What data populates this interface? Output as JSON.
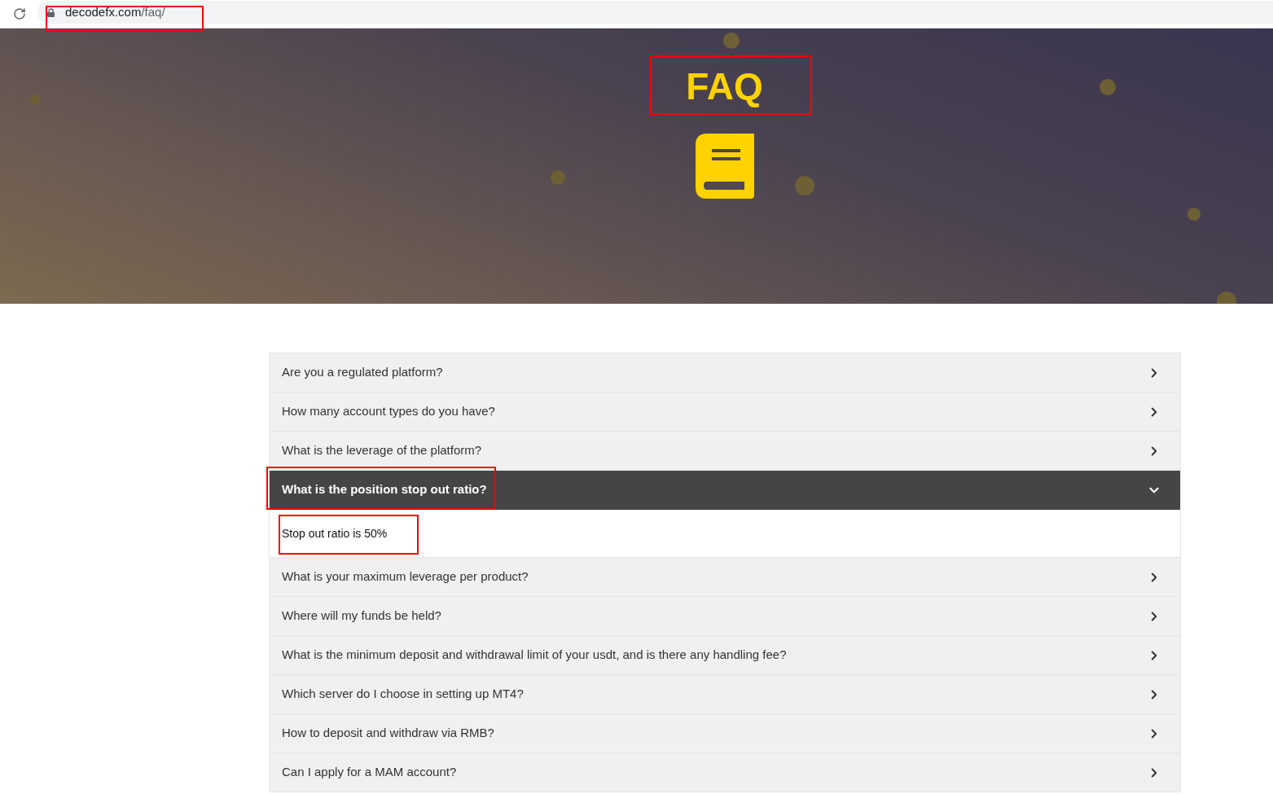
{
  "browser": {
    "url_host": "decodefx.com",
    "url_path": "/faq/",
    "highlighted": true
  },
  "hero": {
    "title": "FAQ",
    "highlighted": true
  },
  "faq": [
    {
      "question": "Are you a regulated platform?",
      "expanded": false,
      "highlighted": false
    },
    {
      "question": "How many account types do you have?",
      "expanded": false,
      "highlighted": false
    },
    {
      "question": "What is the leverage of the platform?",
      "expanded": false,
      "highlighted": false
    },
    {
      "question": "What is the position stop out ratio?",
      "expanded": true,
      "highlighted": true,
      "answer": {
        "text": "Stop out ratio is 50%",
        "highlighted": true
      }
    },
    {
      "question": "What is your maximum leverage per product?",
      "expanded": false,
      "highlighted": false
    },
    {
      "question": "Where will my funds be held?",
      "expanded": false,
      "highlighted": false
    },
    {
      "question": "What is the minimum deposit and withdrawal limit of your usdt, and is there any handling fee?",
      "expanded": false,
      "highlighted": false
    },
    {
      "question": "Which server do I choose in setting up MT4?",
      "expanded": false,
      "highlighted": false
    },
    {
      "question": "How to deposit and withdraw via RMB?",
      "expanded": false,
      "highlighted": false
    },
    {
      "question": "Can I apply for a MAM account?",
      "expanded": false,
      "highlighted": false
    }
  ]
}
